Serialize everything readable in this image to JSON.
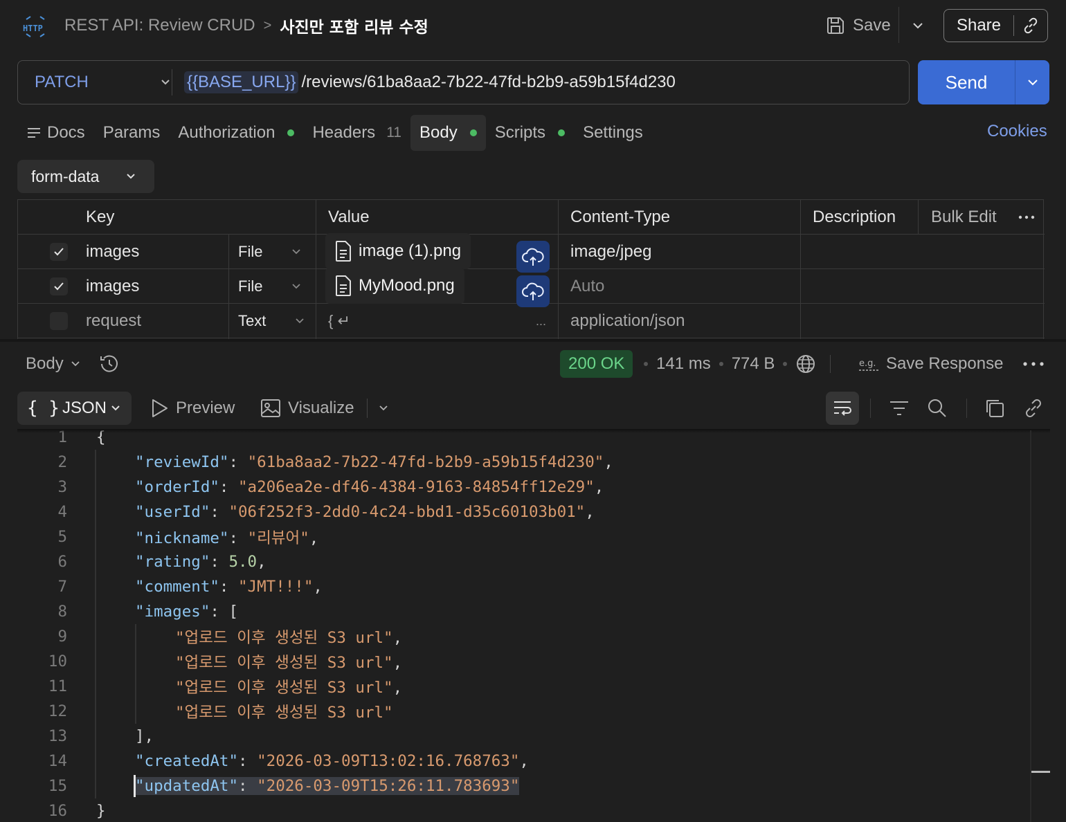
{
  "header": {
    "logo_text": "HTTP",
    "breadcrumb_parent": "REST API: Review CRUD",
    "breadcrumb_sep": ">",
    "breadcrumb_current": "사진만 포함 리뷰 수정",
    "save_label": "Save",
    "share_label": "Share"
  },
  "request": {
    "method": "PATCH",
    "url_variable": "{{BASE_URL}}",
    "url_path": "/reviews/61ba8aa2-7b22-47fd-b2b9-a59b15f4d230",
    "send_label": "Send"
  },
  "tabs": [
    {
      "label": "Docs"
    },
    {
      "label": "Params"
    },
    {
      "label": "Authorization",
      "dot": true
    },
    {
      "label": "Headers",
      "count": "11"
    },
    {
      "label": "Body",
      "dot": true,
      "active": true
    },
    {
      "label": "Scripts",
      "dot": true
    },
    {
      "label": "Settings"
    }
  ],
  "cookies_label": "Cookies",
  "body_type": "form-data",
  "params_table": {
    "headers": {
      "key": "Key",
      "value": "Value",
      "content_type": "Content-Type",
      "description": "Description",
      "bulk_edit": "Bulk Edit"
    },
    "rows": [
      {
        "checked": true,
        "key": "images",
        "type": "File",
        "value": "image (1).png",
        "content_type": "image/jpeg",
        "content_type_muted": false
      },
      {
        "checked": true,
        "key": "images",
        "type": "File",
        "value": "MyMood.png",
        "content_type": "Auto",
        "content_type_muted": true
      },
      {
        "checked": false,
        "key": "request",
        "type": "Text",
        "value": "{ ↵",
        "value_more": "...",
        "content_type": "application/json",
        "content_type_muted": false
      }
    ]
  },
  "response": {
    "body_label": "Body",
    "status": "200 OK",
    "time": "141 ms",
    "size": "774 B",
    "save_response_label": "Save Response",
    "format": "JSON",
    "preview_label": "Preview",
    "visualize_label": "Visualize"
  },
  "code_lines": [
    {
      "n": "1",
      "indent": 0,
      "parts": [
        [
          "p",
          "{"
        ]
      ]
    },
    {
      "n": "2",
      "indent": 1,
      "parts": [
        [
          "k",
          "\"reviewId\""
        ],
        [
          "p",
          ": "
        ],
        [
          "s",
          "\"61ba8aa2-7b22-47fd-b2b9-a59b15f4d230\""
        ],
        [
          "p",
          ","
        ]
      ]
    },
    {
      "n": "3",
      "indent": 1,
      "parts": [
        [
          "k",
          "\"orderId\""
        ],
        [
          "p",
          ": "
        ],
        [
          "s",
          "\"a206ea2e-df46-4384-9163-84854ff12e29\""
        ],
        [
          "p",
          ","
        ]
      ]
    },
    {
      "n": "4",
      "indent": 1,
      "parts": [
        [
          "k",
          "\"userId\""
        ],
        [
          "p",
          ": "
        ],
        [
          "s",
          "\"06f252f3-2dd0-4c24-bbd1-d35c60103b01\""
        ],
        [
          "p",
          ","
        ]
      ]
    },
    {
      "n": "5",
      "indent": 1,
      "parts": [
        [
          "k",
          "\"nickname\""
        ],
        [
          "p",
          ": "
        ],
        [
          "s",
          "\"리뷰어\""
        ],
        [
          "p",
          ","
        ]
      ]
    },
    {
      "n": "6",
      "indent": 1,
      "parts": [
        [
          "k",
          "\"rating\""
        ],
        [
          "p",
          ": "
        ],
        [
          "n",
          "5.0"
        ],
        [
          "p",
          ","
        ]
      ]
    },
    {
      "n": "7",
      "indent": 1,
      "parts": [
        [
          "k",
          "\"comment\""
        ],
        [
          "p",
          ": "
        ],
        [
          "s",
          "\"JMT!!!\""
        ],
        [
          "p",
          ","
        ]
      ]
    },
    {
      "n": "8",
      "indent": 1,
      "parts": [
        [
          "k",
          "\"images\""
        ],
        [
          "p",
          ": ["
        ]
      ]
    },
    {
      "n": "9",
      "indent": 2,
      "parts": [
        [
          "s",
          "\"업로드 이후 생성된 S3 url\""
        ],
        [
          "p",
          ","
        ]
      ]
    },
    {
      "n": "10",
      "indent": 2,
      "parts": [
        [
          "s",
          "\"업로드 이후 생성된 S3 url\""
        ],
        [
          "p",
          ","
        ]
      ]
    },
    {
      "n": "11",
      "indent": 2,
      "parts": [
        [
          "s",
          "\"업로드 이후 생성된 S3 url\""
        ],
        [
          "p",
          ","
        ]
      ]
    },
    {
      "n": "12",
      "indent": 2,
      "parts": [
        [
          "s",
          "\"업로드 이후 생성된 S3 url\""
        ]
      ]
    },
    {
      "n": "13",
      "indent": 1,
      "parts": [
        [
          "p",
          "],"
        ]
      ]
    },
    {
      "n": "14",
      "indent": 1,
      "parts": [
        [
          "k",
          "\"createdAt\""
        ],
        [
          "p",
          ": "
        ],
        [
          "s",
          "\"2026-03-09T13:02:16.768763\""
        ],
        [
          "p",
          ","
        ]
      ]
    },
    {
      "n": "15",
      "indent": 1,
      "selected": true,
      "parts": [
        [
          "k",
          "\"updatedAt\""
        ],
        [
          "p",
          ": "
        ],
        [
          "s",
          "\"2026-03-09T15:26:11.783693\""
        ]
      ]
    },
    {
      "n": "16",
      "indent": 0,
      "parts": [
        [
          "p",
          "}"
        ]
      ]
    }
  ]
}
